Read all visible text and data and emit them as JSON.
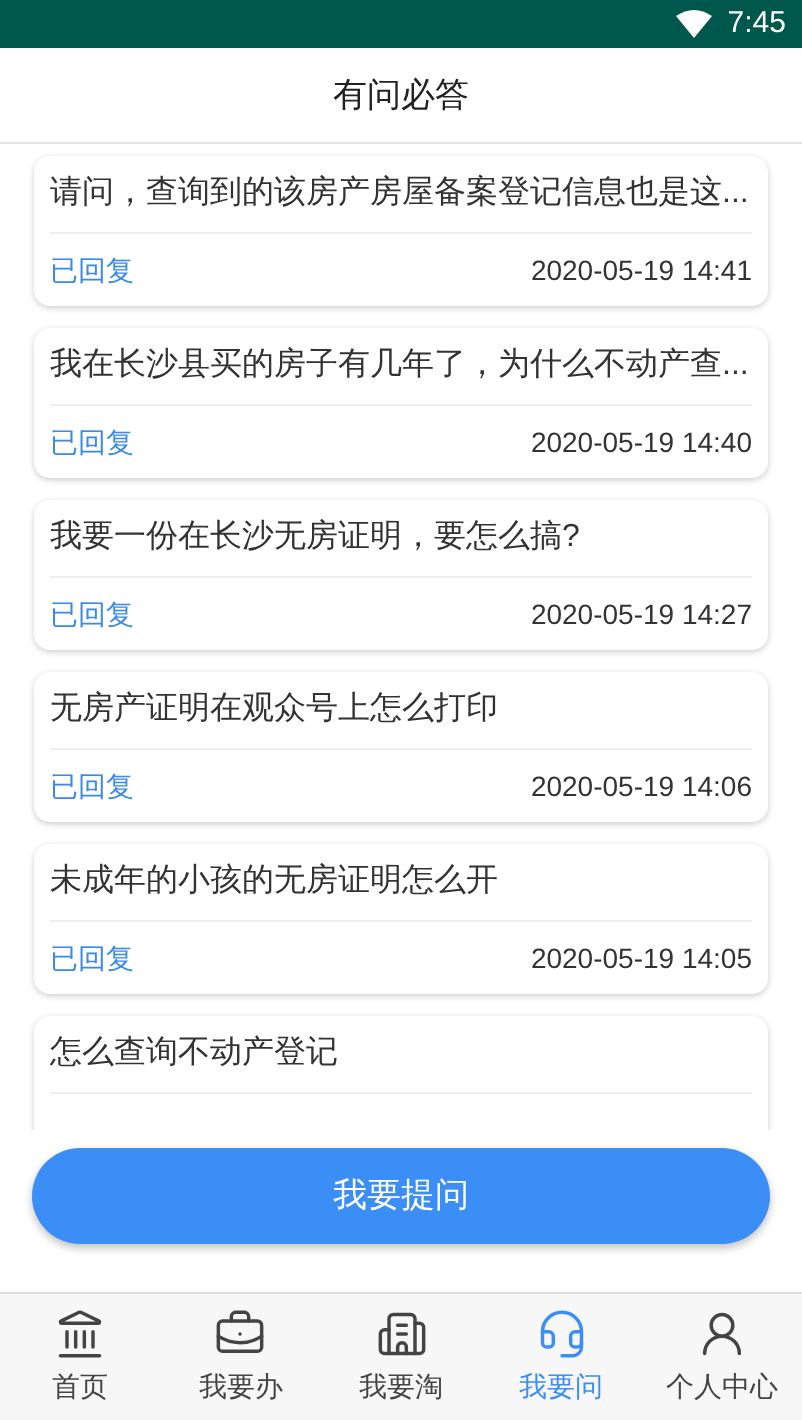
{
  "status_bar": {
    "time": "7:45"
  },
  "header": {
    "title": "有问必答"
  },
  "questions": [
    {
      "title": "请问，查询到的该房产房屋备案登记信息也是这...",
      "status": "已回复",
      "time": "2020-05-19 14:41"
    },
    {
      "title": "我在长沙县买的房子有几年了，为什么不动产查...",
      "status": "已回复",
      "time": "2020-05-19 14:40"
    },
    {
      "title": "我要一份在长沙无房证明，要怎么搞?",
      "status": "已回复",
      "time": "2020-05-19 14:27"
    },
    {
      "title": "无房产证明在观众号上怎么打印",
      "status": "已回复",
      "time": "2020-05-19 14:06"
    },
    {
      "title": "未成年的小孩的无房证明怎么开",
      "status": "已回复",
      "time": "2020-05-19 14:05"
    },
    {
      "title": "怎么查询不动产登记"
    }
  ],
  "ask_button": "我要提问",
  "tabs": [
    {
      "label": "首页",
      "kind": "home",
      "selected": false
    },
    {
      "label": "我要办",
      "kind": "handle",
      "selected": false
    },
    {
      "label": "我要淘",
      "kind": "browse",
      "selected": false
    },
    {
      "label": "我要问",
      "kind": "ask",
      "selected": true
    },
    {
      "label": "个人中心",
      "kind": "profile",
      "selected": false
    }
  ]
}
